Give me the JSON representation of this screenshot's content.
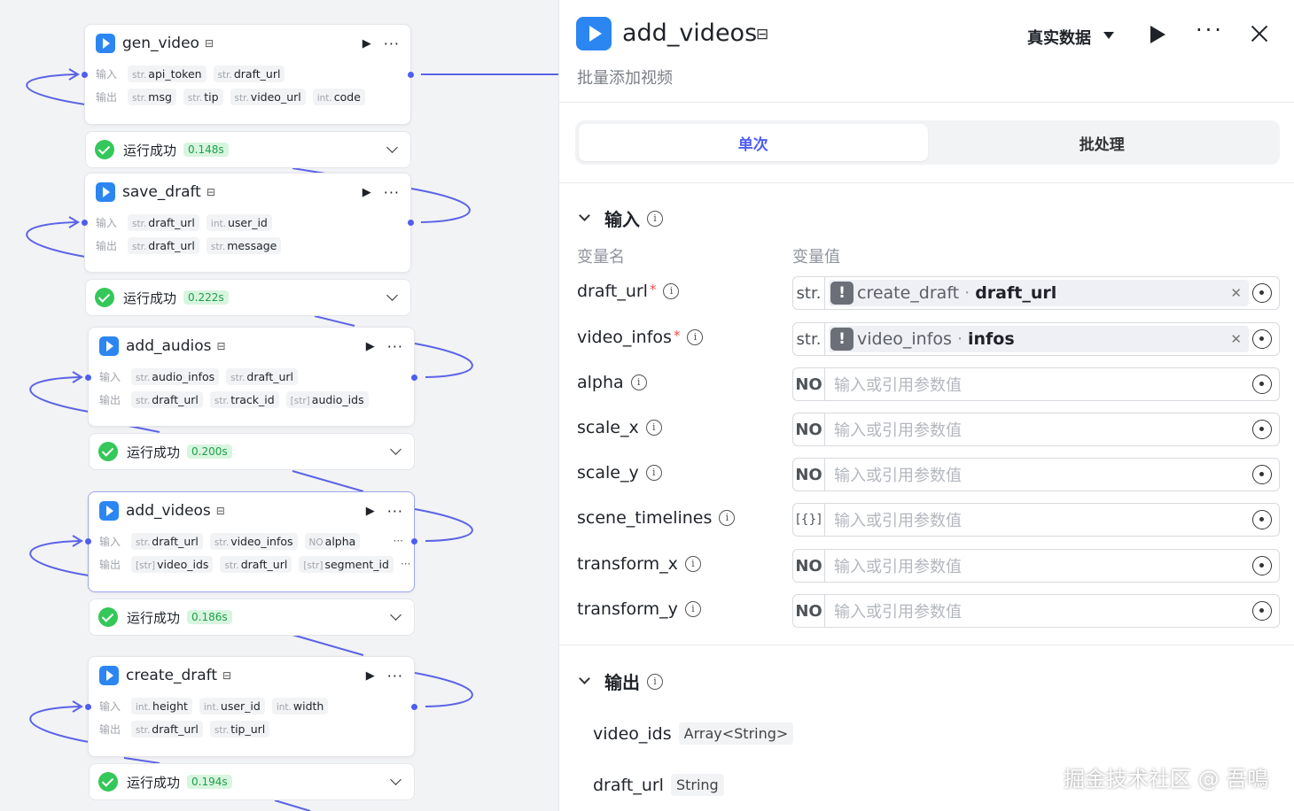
{
  "canvas": {
    "nodes": [
      {
        "title": "gen_video",
        "input_label": "输入",
        "output_label": "输出",
        "inputs": [
          {
            "t": "str.",
            "n": "api_token"
          },
          {
            "t": "str.",
            "n": "draft_url"
          }
        ],
        "outputs": [
          {
            "t": "str.",
            "n": "msg"
          },
          {
            "t": "str.",
            "n": "tip"
          },
          {
            "t": "str.",
            "n": "video_url"
          },
          {
            "t": "int.",
            "n": "code"
          }
        ],
        "status": "运行成功",
        "time": "0.148s"
      },
      {
        "title": "save_draft",
        "input_label": "输入",
        "output_label": "输出",
        "inputs": [
          {
            "t": "str.",
            "n": "draft_url"
          },
          {
            "t": "int.",
            "n": "user_id"
          }
        ],
        "outputs": [
          {
            "t": "str.",
            "n": "draft_url"
          },
          {
            "t": "str.",
            "n": "message"
          }
        ],
        "status": "运行成功",
        "time": "0.222s"
      },
      {
        "title": "add_audios",
        "input_label": "输入",
        "output_label": "输出",
        "inputs": [
          {
            "t": "str.",
            "n": "audio_infos"
          },
          {
            "t": "str.",
            "n": "draft_url"
          }
        ],
        "outputs": [
          {
            "t": "str.",
            "n": "draft_url"
          },
          {
            "t": "str.",
            "n": "track_id"
          },
          {
            "t": "[str]",
            "n": "audio_ids"
          }
        ],
        "status": "运行成功",
        "time": "0.200s"
      },
      {
        "title": "add_videos",
        "input_label": "输入",
        "output_label": "输出",
        "inputs": [
          {
            "t": "str.",
            "n": "draft_url"
          },
          {
            "t": "str.",
            "n": "video_infos"
          },
          {
            "t": "NO",
            "n": "alpha"
          }
        ],
        "outputs": [
          {
            "t": "[str]",
            "n": "video_ids"
          },
          {
            "t": "str.",
            "n": "draft_url"
          },
          {
            "t": "[str]",
            "n": "segment_id"
          }
        ],
        "more": "···",
        "status": "运行成功",
        "time": "0.186s"
      },
      {
        "title": "create_draft",
        "input_label": "输入",
        "output_label": "输出",
        "inputs": [
          {
            "t": "int.",
            "n": "height"
          },
          {
            "t": "int.",
            "n": "user_id"
          },
          {
            "t": "int.",
            "n": "width"
          }
        ],
        "outputs": [
          {
            "t": "str.",
            "n": "draft_url"
          },
          {
            "t": "str.",
            "n": "tip_url"
          }
        ],
        "status": "运行成功",
        "time": "0.194s"
      }
    ]
  },
  "panel": {
    "title": "add_videos",
    "subtitle": "批量添加视频",
    "data_mode": "真实数据",
    "tabs": [
      "单次",
      "批处理"
    ],
    "input_section": "输入",
    "col_name": "变量名",
    "col_value": "变量值",
    "params": [
      {
        "name": "draft_url",
        "required": "*",
        "type": "str.",
        "ref_src": "create_draft",
        "ref_field": "draft_url"
      },
      {
        "name": "video_infos",
        "required": "*",
        "type": "str.",
        "ref_src": "video_infos",
        "ref_field": "infos"
      },
      {
        "name": "alpha",
        "type": "NO",
        "placeholder": "输入或引用参数值"
      },
      {
        "name": "scale_x",
        "type": "NO",
        "placeholder": "输入或引用参数值"
      },
      {
        "name": "scale_y",
        "type": "NO",
        "placeholder": "输入或引用参数值"
      },
      {
        "name": "scene_timelines",
        "type": "[{}]",
        "placeholder": "输入或引用参数值"
      },
      {
        "name": "transform_x",
        "type": "NO",
        "placeholder": "输入或引用参数值"
      },
      {
        "name": "transform_y",
        "type": "NO",
        "placeholder": "输入或引用参数值"
      }
    ],
    "output_section": "输出",
    "outputs": [
      {
        "name": "video_ids",
        "type": "Array<String>"
      },
      {
        "name": "draft_url",
        "type": "String"
      }
    ]
  },
  "watermark": "掘金技术社区 @ 吾鳴",
  "colors": {
    "accent": "#4e5ef0",
    "node_icon": "#2b86f2",
    "success": "#34c759",
    "wire": "#5b63e6"
  }
}
